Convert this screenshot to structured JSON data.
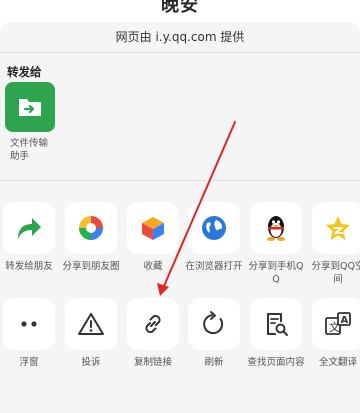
{
  "background": {
    "title": "晚安"
  },
  "sheet": {
    "provider_text": "网页由 i.y.qq.com 提供",
    "forward_label": "转发给",
    "contact": {
      "name": "文件传输助手"
    }
  },
  "share_row": [
    {
      "label": "转发给朋友"
    },
    {
      "label": "分享到朋友圈"
    },
    {
      "label": "收藏"
    },
    {
      "label": "在浏览器打开"
    },
    {
      "label": "分享到手机QQ"
    },
    {
      "label": "分享到QQ空间"
    }
  ],
  "tools_row": [
    {
      "label": "浮窗"
    },
    {
      "label": "投诉"
    },
    {
      "label": "复制链接"
    },
    {
      "label": "刷新"
    },
    {
      "label": "查找页面内容"
    },
    {
      "label": "全文翻译"
    }
  ],
  "colors": {
    "wechat_green": "#2ea44f",
    "annotation_red": "#e02525",
    "sheet_bg": "#f5f5f5"
  }
}
